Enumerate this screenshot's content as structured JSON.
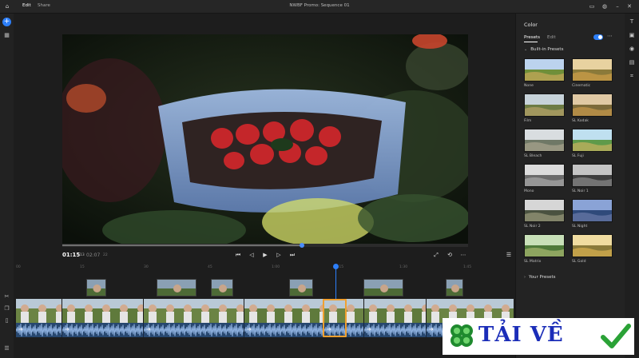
{
  "topbar": {
    "tabs": [
      "Edit",
      "Share"
    ],
    "active_tab": "Edit",
    "title": "NWBF Promo: Sequence 01"
  },
  "icons": {
    "home": "home-icon",
    "add": "plus-icon",
    "media": "media-icon",
    "chat": "chat-icon",
    "user": "user-icon",
    "minimize": "minimize-icon",
    "close": "close-icon"
  },
  "transport": {
    "current_time": "01:15",
    "current_frames": "13",
    "total_time": "02:07",
    "total_frames": "22",
    "buttons": [
      "go-to-start",
      "step-back",
      "play",
      "step-forward",
      "go-to-end"
    ],
    "progress_fraction": 0.59
  },
  "timeline": {
    "ruler_ticks": [
      "00",
      "15",
      "30",
      "45",
      "1:00",
      "1:15",
      "1:30",
      "1:45"
    ],
    "playhead_fraction": 0.64
  },
  "panel": {
    "title": "Color",
    "tabs": [
      "Presets",
      "Edit"
    ],
    "active_tab": "Presets",
    "section_builtin": "Built-in Presets",
    "presets": [
      {
        "name": "None",
        "tone": "normal"
      },
      {
        "name": "Cinematic",
        "tone": "warm"
      },
      {
        "name": "Film",
        "tone": "film"
      },
      {
        "name": "SL Kodak",
        "tone": "kodak"
      },
      {
        "name": "SL Bleach",
        "tone": "bleach"
      },
      {
        "name": "SL Fuji",
        "tone": "fuji"
      },
      {
        "name": "Mono",
        "tone": "mono"
      },
      {
        "name": "SL Noir 1",
        "tone": "noir"
      },
      {
        "name": "SL Noir 2",
        "tone": "noir2"
      },
      {
        "name": "SL Night",
        "tone": "night"
      },
      {
        "name": "SL Matrix",
        "tone": "matrix"
      },
      {
        "name": "SL Gold",
        "tone": "gold"
      }
    ],
    "section_your": "Your Presets"
  },
  "watermark": {
    "text": "TẢI VỀ"
  }
}
